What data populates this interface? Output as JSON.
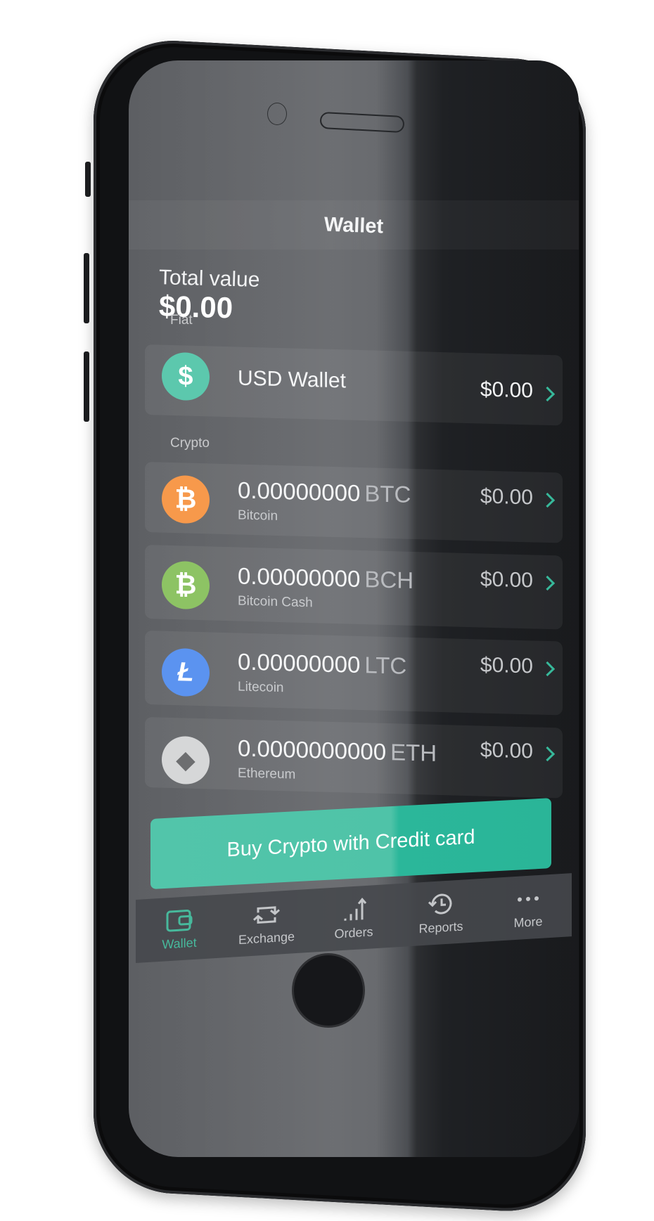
{
  "header": {
    "title": "Wallet"
  },
  "summary": {
    "label": "Total value",
    "value": "$0.00"
  },
  "sections": {
    "fiat": "Fiat",
    "crypto": "Crypto"
  },
  "fiat_wallet": {
    "name": "USD Wallet",
    "value": "$0.00",
    "icon": "dollar-icon",
    "color": "#5cc8ad"
  },
  "crypto_wallets": [
    {
      "amount": "0.00000000",
      "unit": "BTC",
      "name": "Bitcoin",
      "value": "$0.00",
      "icon": "bitcoin-icon",
      "glyph": "₿",
      "color": "#f7994b"
    },
    {
      "amount": "0.00000000",
      "unit": "BCH",
      "name": "Bitcoin Cash",
      "value": "$0.00",
      "icon": "bitcoin-cash-icon",
      "glyph": "₿",
      "color": "#8dc364"
    },
    {
      "amount": "0.00000000",
      "unit": "LTC",
      "name": "Litecoin",
      "value": "$0.00",
      "icon": "litecoin-icon",
      "glyph": "Ł",
      "color": "#5b93f0"
    },
    {
      "amount": "0.0000000000",
      "unit": "ETH",
      "name": "Ethereum",
      "value": "$0.00",
      "icon": "ethereum-icon",
      "glyph": "◆",
      "color": "#d6d7d8"
    }
  ],
  "cta": {
    "label": "Buy Crypto with Credit card",
    "color": "#4fc3a8"
  },
  "tabs": [
    {
      "label": "Wallet",
      "icon": "wallet-icon",
      "active": true
    },
    {
      "label": "Exchange",
      "icon": "exchange-icon",
      "active": false
    },
    {
      "label": "Orders",
      "icon": "orders-icon",
      "active": false
    },
    {
      "label": "Reports",
      "icon": "history-icon",
      "active": false
    },
    {
      "label": "More",
      "icon": "more-icon",
      "active": false
    }
  ],
  "accent_color": "#37b89a"
}
